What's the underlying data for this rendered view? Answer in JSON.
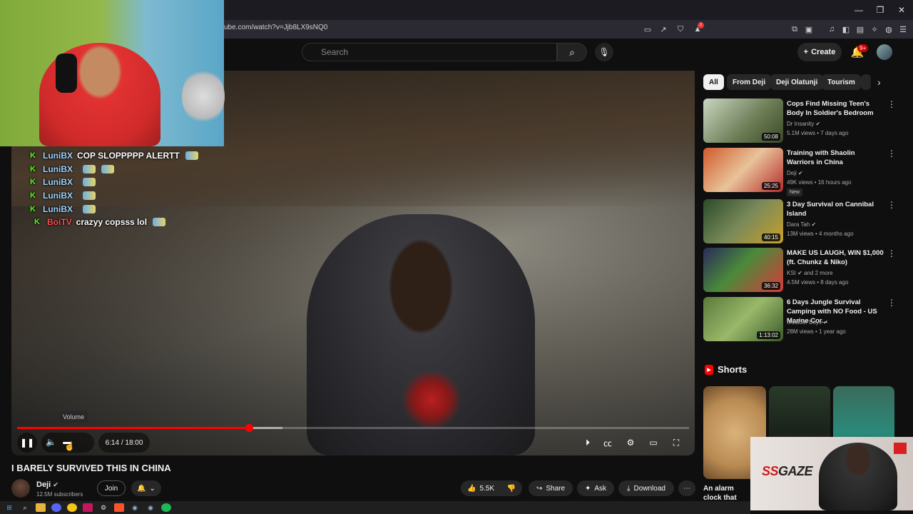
{
  "browser": {
    "url": "ube.com/watch?v=Jjb8LX9sNQ0",
    "window_controls": {
      "minimize": "—",
      "restore": "❐",
      "close": "✕"
    },
    "notif_count": "2"
  },
  "header": {
    "search_placeholder": "Search",
    "create_label": "Create",
    "notif_badge": "9+"
  },
  "stream_overlay": {
    "chat": [
      {
        "user": "LuniBX",
        "message": "COP SLOPPPPP ALERTT",
        "emotes": 1
      },
      {
        "user": "LuniBX",
        "message": "",
        "emotes": 2
      },
      {
        "user": "LuniBX",
        "message": "",
        "emotes": 1
      },
      {
        "user": "LuniBX",
        "message": "",
        "emotes": 1
      },
      {
        "user": "LuniBX",
        "message": "",
        "emotes": 1
      },
      {
        "user": "BoiTV",
        "message": "crazyy copsss lol",
        "emotes": 1
      }
    ],
    "user_colors": {
      "LuniBX": "#9fd3ff",
      "BoiTV": "#ff4d4d"
    }
  },
  "player": {
    "time": "6:14 / 18:00",
    "progress_fraction": 0.345,
    "buffer_fraction": 0.395,
    "volume_tooltip": "Volume"
  },
  "video": {
    "title": "I BARELY SURVIVED THIS IN CHINA",
    "channel": "Deji",
    "subscribers": "12.5M subscribers",
    "join_label": "Join",
    "likes": "5.5K",
    "share_label": "Share",
    "ask_label": "Ask",
    "download_label": "Download"
  },
  "sidebar": {
    "chips": [
      "All",
      "From Deji",
      "Deji Olatunji",
      "Tourism"
    ],
    "related": [
      {
        "title": "Cops Find Missing Teen's Body In Soldier's Bedroom",
        "channel": "Dr Insanity",
        "meta": "5.1M views • 7 days ago",
        "duration": "50:08",
        "verified": true
      },
      {
        "title": "Training with Shaolin Warriors in China",
        "channel": "Deji",
        "meta": "49K views • 16 hours ago",
        "duration": "25:25",
        "badge": "New",
        "verified": true
      },
      {
        "title": "3 Day Survival on Cannibal Island",
        "channel": "Dara Tah",
        "meta": "13M views • 4 months ago",
        "duration": "40:15",
        "verified": true
      },
      {
        "title": "MAKE US LAUGH, WIN $1,000 (ft. Chunkz & Niko)",
        "channel": "KSI",
        "channel_suffix": "and 2 more",
        "meta": "4.5M views • 8 days ago",
        "duration": "36:32",
        "verified": true
      },
      {
        "title": "6 Days Jungle Survival Camping with NO Food - US Marine Cor...",
        "channel": "Outdoor Boys",
        "meta": "28M views • 1 year ago",
        "duration": "1:13:02",
        "verified": true
      }
    ],
    "shorts_heading": "Shorts",
    "short_caption": "An alarm clock that"
  },
  "sponsor": {
    "brand_prefix": "SS",
    "brand_name": "GAZE"
  },
  "colors": {
    "accent": "#ff0000",
    "bg": "#0f0f0f",
    "chip_bg": "#272727"
  }
}
